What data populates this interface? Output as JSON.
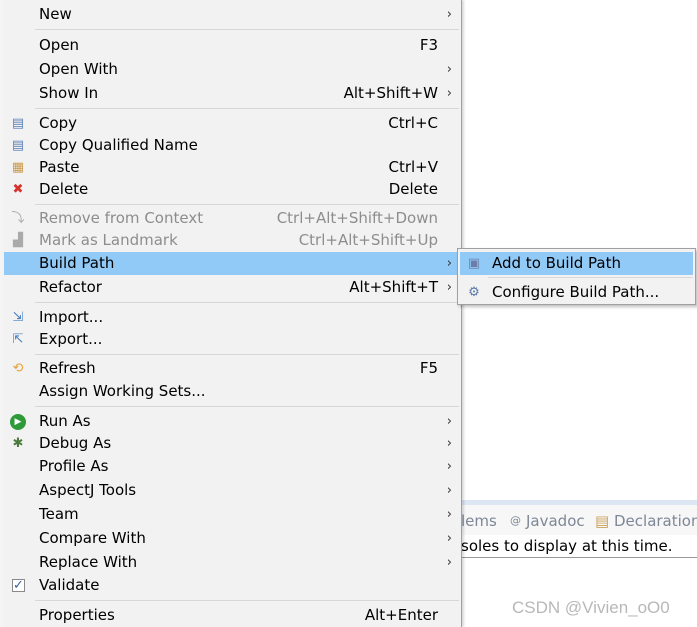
{
  "menu": {
    "items": [
      {
        "label": "New",
        "arrow": true
      },
      {
        "label": "Open",
        "shortcut": "F3"
      },
      {
        "label": "Open With",
        "arrow": true
      },
      {
        "label": "Show In",
        "shortcut": "Alt+Shift+W",
        "arrow": true
      },
      {
        "label": "Copy",
        "shortcut": "Ctrl+C",
        "icon": "copy-icon"
      },
      {
        "label": "Copy Qualified Name",
        "icon": "copy-qualified-name-icon"
      },
      {
        "label": "Paste",
        "shortcut": "Ctrl+V",
        "icon": "paste-icon"
      },
      {
        "label": "Delete",
        "shortcut": "Delete",
        "icon": "delete-icon"
      },
      {
        "label": "Remove from Context",
        "shortcut": "Ctrl+Alt+Shift+Down",
        "disabled": true,
        "icon": "remove-context-icon"
      },
      {
        "label": "Mark as Landmark",
        "shortcut": "Ctrl+Alt+Shift+Up",
        "disabled": true,
        "icon": "landmark-icon"
      },
      {
        "label": "Build Path",
        "arrow": true,
        "highlighted": true
      },
      {
        "label": "Refactor",
        "shortcut": "Alt+Shift+T",
        "arrow": true
      },
      {
        "label": "Import...",
        "icon": "import-icon"
      },
      {
        "label": "Export...",
        "icon": "export-icon"
      },
      {
        "label": "Refresh",
        "shortcut": "F5",
        "icon": "refresh-icon"
      },
      {
        "label": "Assign Working Sets..."
      },
      {
        "label": "Run As",
        "arrow": true,
        "icon": "run-icon"
      },
      {
        "label": "Debug As",
        "arrow": true,
        "icon": "debug-icon"
      },
      {
        "label": "Profile As",
        "arrow": true
      },
      {
        "label": "AspectJ Tools",
        "arrow": true
      },
      {
        "label": "Team",
        "arrow": true
      },
      {
        "label": "Compare With",
        "arrow": true
      },
      {
        "label": "Replace With",
        "arrow": true
      },
      {
        "label": "Validate",
        "icon": "checkbox-checked-icon"
      },
      {
        "label": "Properties",
        "shortcut": "Alt+Enter"
      }
    ]
  },
  "submenu": {
    "items": [
      {
        "label": "Add to Build Path",
        "highlighted": true,
        "icon": "jar-icon"
      },
      {
        "label": "Configure Build Path...",
        "icon": "configure-build-path-icon"
      }
    ]
  },
  "background_panel": {
    "tabs": [
      "lems",
      "Javadoc",
      "Declaration"
    ],
    "message": "soles to display at this time."
  },
  "watermark": "CSDN @Vivien_oO0",
  "colors": {
    "highlight": "#91c9f7",
    "menu_bg": "#f2f2f2",
    "disabled_text": "#8d8d8d"
  }
}
